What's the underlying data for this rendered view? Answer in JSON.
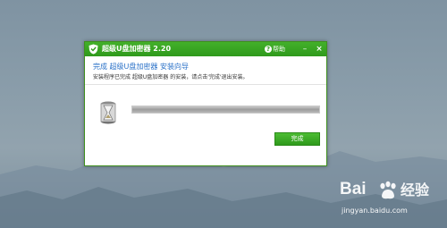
{
  "window": {
    "title": "超级U盘加密器  2.20",
    "help_label": "帮助",
    "minimize_glyph": "–",
    "close_glyph": "×"
  },
  "content": {
    "heading": "完成 超级U盘加密器 安装向导",
    "subtext": "安装程序已完成 超级U盘加密器 的安装，请点击'完成'退出安装。"
  },
  "progress": {
    "fraction": 1.0
  },
  "buttons": {
    "finish_label": "完成"
  },
  "watermark": {
    "brand_a": "Bai",
    "brand_b": "经验",
    "url": "jingyan.baidu.com"
  },
  "icons": {
    "app_logo": "shield-icon",
    "help": "help-icon",
    "installer": "hourglass-icon",
    "watermark": "paw-icon"
  },
  "colors": {
    "title_bar": "#2f9a1c",
    "heading": "#2a71c8",
    "button": "#3aab25"
  }
}
